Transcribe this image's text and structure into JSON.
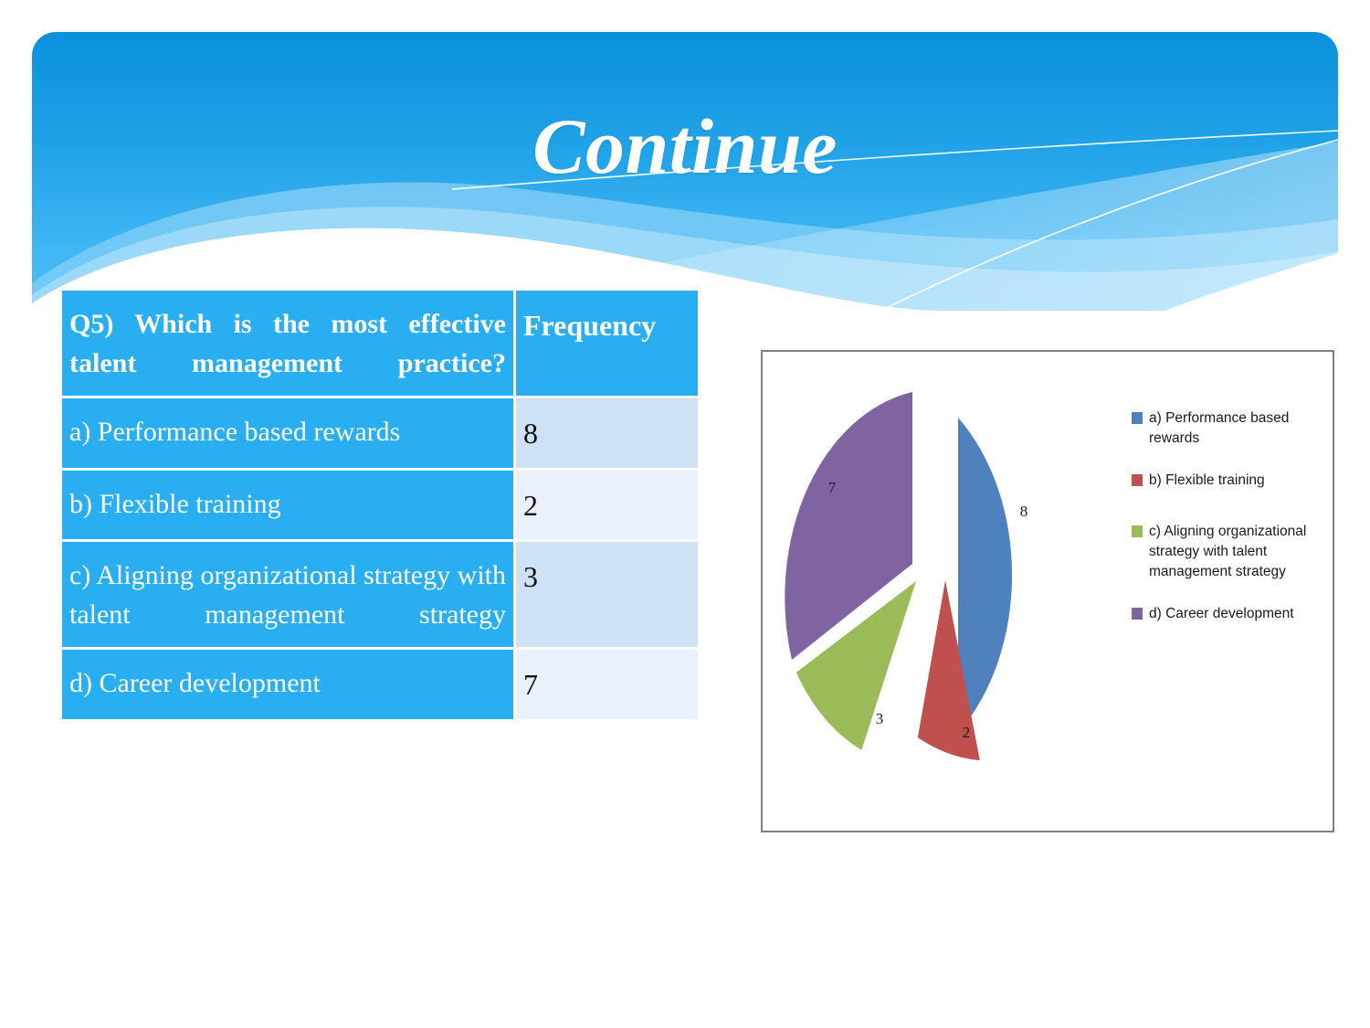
{
  "slide": {
    "title": "Continue"
  },
  "table": {
    "header": {
      "question": "Q5)  Which  is  the  most  effective  talent  management  practice?",
      "frequency_label": "Frequency"
    },
    "rows": [
      {
        "label": "a) Performance based rewards",
        "frequency": "8"
      },
      {
        "label": "b) Flexible training",
        "frequency": "2"
      },
      {
        "label": "c)  Aligning  organizational  strategy  with  talent  management strategy",
        "frequency": "3"
      },
      {
        "label": "d) Career development",
        "frequency": "7"
      }
    ]
  },
  "chart_data": {
    "type": "pie",
    "title": "",
    "categories": [
      "a) Performance based rewards",
      "b) Flexible training",
      "c) Aligning organizational strategy with talent management strategy",
      "d) Career development"
    ],
    "values": [
      8,
      2,
      3,
      7
    ],
    "labels": [
      "8",
      "2",
      "3",
      "7"
    ],
    "colors": [
      "#4F81BD",
      "#C0504D",
      "#9BBB59",
      "#8064A2"
    ],
    "legend_position": "right",
    "exploded": true,
    "grid": false
  },
  "legend": {
    "entries": [
      {
        "label": "a) Performance based rewards",
        "color": "#4F81BD"
      },
      {
        "label": "b) Flexible training",
        "color": "#C0504D"
      },
      {
        "label": "c) Aligning organizational strategy with talent management strategy",
        "color": "#9BBB59"
      },
      {
        "label": "d) Career development",
        "color": "#8064A2"
      }
    ]
  },
  "colors": {
    "banner_top": "#0b91dc",
    "banner_bottom": "#56c0f6",
    "table_label_bg": "#29AEF2",
    "table_freq_odd": "#CFE1F4",
    "table_freq_even": "#E8F1FC"
  }
}
